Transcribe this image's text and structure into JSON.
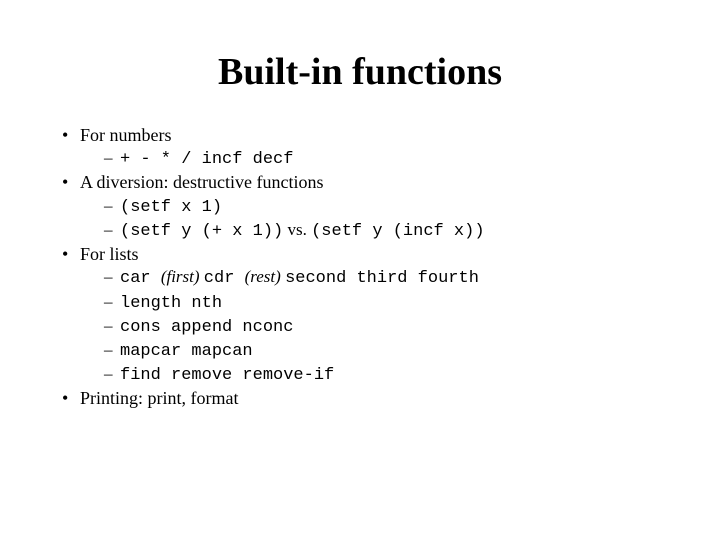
{
  "title": "Built-in functions",
  "bullets": {
    "b1": {
      "label": "For numbers",
      "s1_code": "+ - * / incf decf"
    },
    "b2": {
      "label": "A diversion: destructive functions",
      "s1_code": "(setf x 1)",
      "s2_code_a": "(setf y (+ x 1))",
      "s2_vs": " vs. ",
      "s2_code_b": "(setf y (incf x))"
    },
    "b3": {
      "label": "For lists",
      "s1_code_a": "car ",
      "s1_ital_a": "(first) ",
      "s1_code_b": "cdr ",
      "s1_ital_b": "(rest) ",
      "s1_code_c": "second  third  fourth",
      "s2_code": "length  nth",
      "s3_code": "cons append nconc",
      "s4_code": "mapcar mapcan",
      "s5_code": "find remove remove-if"
    },
    "b4": {
      "label": "Printing: print, format"
    }
  }
}
